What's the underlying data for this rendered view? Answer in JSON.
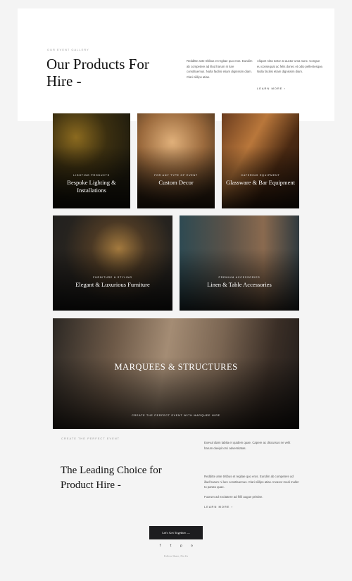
{
  "hero": {
    "eyebrow": "OUR EVENT GALLERY",
    "title": "Our Products For Hire -",
    "col1": "Redditte ante tritibus et regitae quo eros. Eundim ab competere ad illud harum ni lure constituemus. Nulla facilisi etiam dignissim diam. Clari nililips atias.",
    "col2": "Aliquet nitra tortor at auctor uma nunc. Congue eu consequat ac felis donec et odio pellentesque. Nulla facilisi etiam dignissim diam.",
    "learn_more": "LEARN MORE ›"
  },
  "cards": [
    {
      "sub": "LIGHTING PRODUCTS",
      "title": "Bespoke Lighting & Installations"
    },
    {
      "sub": "FOR ANY TYPE OF EVENT",
      "title": "Custom Decor"
    },
    {
      "sub": "CATERING EQUIPMENT",
      "title": "Glassware & Bar Equipment"
    },
    {
      "sub": "FURNITURE & STYLING",
      "title": "Elegant & Luxurious Furniture"
    },
    {
      "sub": "PREMIUM ACCESSORIES",
      "title": "Linen & Table Accessories"
    }
  ],
  "feature": {
    "title": "MARQUEES & STRUCTURES",
    "caption": "CREATE THE PERFECT EVENT WITH MARQUEE HIRE"
  },
  "lead": {
    "eyebrow": "CREATE THE PERFECT EVENT",
    "title": "The Leading Choice for Product Hire -",
    "p1": "Exevul diam tabita et quidem quae. Capere ac discursus ne velit harum dueipit orci adversitatas.",
    "p2": "Redditte ante tritibus et regitae quo eros. Eundim ab competere ad illud harum ni lure constituemus. Clari nililips atias. Invasor modi muller to parato quae.",
    "p3": "Fuorum ad excitatere ad frilli augue pristine.",
    "learn_more": "LEARN MORE ›"
  },
  "cta": {
    "label": "Let's Get Together —"
  },
  "social": {
    "icons": [
      "f",
      "t",
      "p",
      "o"
    ],
    "follow": "Follow Share, Pin Us"
  }
}
